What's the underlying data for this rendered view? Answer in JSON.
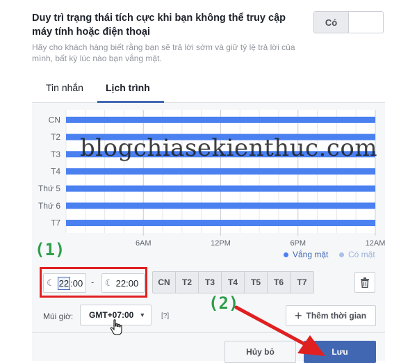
{
  "header": {
    "title": "Duy trì trạng thái tích cực khi bạn không thể truy cập máy tính hoặc điện thoại",
    "description": "Hãy cho khách hàng biết rằng bạn sẽ trả lời sớm và giữ tỷ lệ trả lời của mình, bất kỳ lúc nào bạn vắng mặt.",
    "toggle_label": "Có"
  },
  "tabs": [
    {
      "label": "Tin nhắn",
      "active": false
    },
    {
      "label": "Lịch trình",
      "active": true
    }
  ],
  "chart_data": {
    "type": "bar",
    "orientation": "horizontal-timeline",
    "categories": [
      "CN",
      "T2",
      "T3",
      "T4",
      "Thứ 5",
      "Thứ 6",
      "T7"
    ],
    "x_ticks": [
      "6AM",
      "12PM",
      "6PM",
      "12AM"
    ],
    "xlim": [
      0,
      24
    ],
    "series": [
      {
        "name": "Vắng mặt",
        "color": "#4a80f0",
        "intervals": [
          [
            0,
            24
          ],
          [
            0,
            24
          ],
          [
            0,
            24
          ],
          [
            0,
            24
          ],
          [
            0,
            24
          ],
          [
            0,
            24
          ],
          [
            0,
            24
          ]
        ]
      }
    ],
    "legend": [
      "Vắng mặt",
      "Có mặt"
    ],
    "legend_position": "bottom-right",
    "grid": true
  },
  "schedule": {
    "start_hour": "22",
    "start_min": "00",
    "dash": "-",
    "end_time": "22:00",
    "days": [
      "CN",
      "T2",
      "T3",
      "T4",
      "T5",
      "T6",
      "T7"
    ]
  },
  "timezone": {
    "label": "Múi giờ:",
    "value": "GMT+07:00",
    "help": "[?]"
  },
  "buttons": {
    "add_time": "Thêm thời gian",
    "cancel": "Hủy bỏ",
    "save": "Lưu"
  },
  "annotations": {
    "step1": "(1)",
    "step2": "(2)",
    "watermark": "blogchiasekienthuc.com"
  },
  "colors": {
    "accent": "#4267b2",
    "bar": "#4a80f0",
    "annotation_green": "#2e9e4a",
    "annotation_red": "#e02020"
  }
}
